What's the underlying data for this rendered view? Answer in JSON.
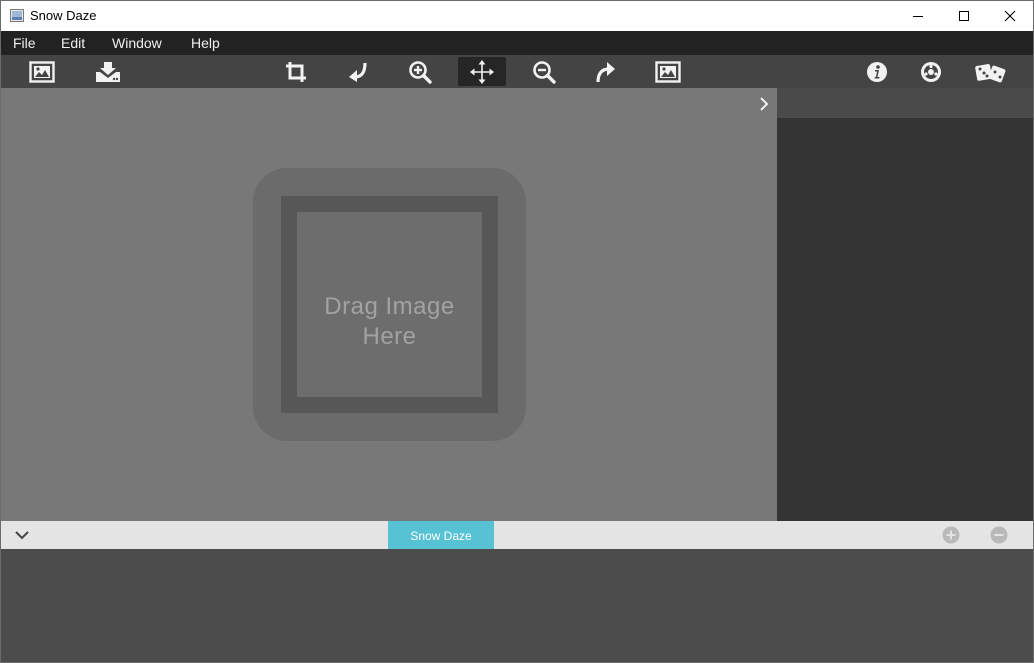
{
  "window": {
    "title": "Snow Daze",
    "controls": [
      "minimize-icon",
      "maximize-icon",
      "close-icon"
    ]
  },
  "menu": {
    "items": [
      {
        "label": "File"
      },
      {
        "label": "Edit"
      },
      {
        "label": "Window"
      },
      {
        "label": "Help"
      }
    ]
  },
  "toolbar": {
    "left_tools": [
      "open-image-icon",
      "save-download-icon"
    ],
    "center_tools": [
      "crop-icon",
      "undo-icon",
      "zoom-in-icon",
      "move-icon",
      "zoom-out-icon",
      "redo-icon",
      "fit-image-icon"
    ],
    "active_tool": "move-icon",
    "right_tools": [
      "info-icon",
      "settings-icon",
      "randomize-dice-icon"
    ]
  },
  "canvas": {
    "drop_text_line1": "Drag Image",
    "drop_text_line2": "Here",
    "background": "#787878"
  },
  "tabs": {
    "items": [
      {
        "label": "Snow Daze",
        "selected": true
      }
    ],
    "accent": "#56c2d4",
    "add_icon": "plus-circle-icon",
    "remove_icon": "minus-circle-icon"
  }
}
